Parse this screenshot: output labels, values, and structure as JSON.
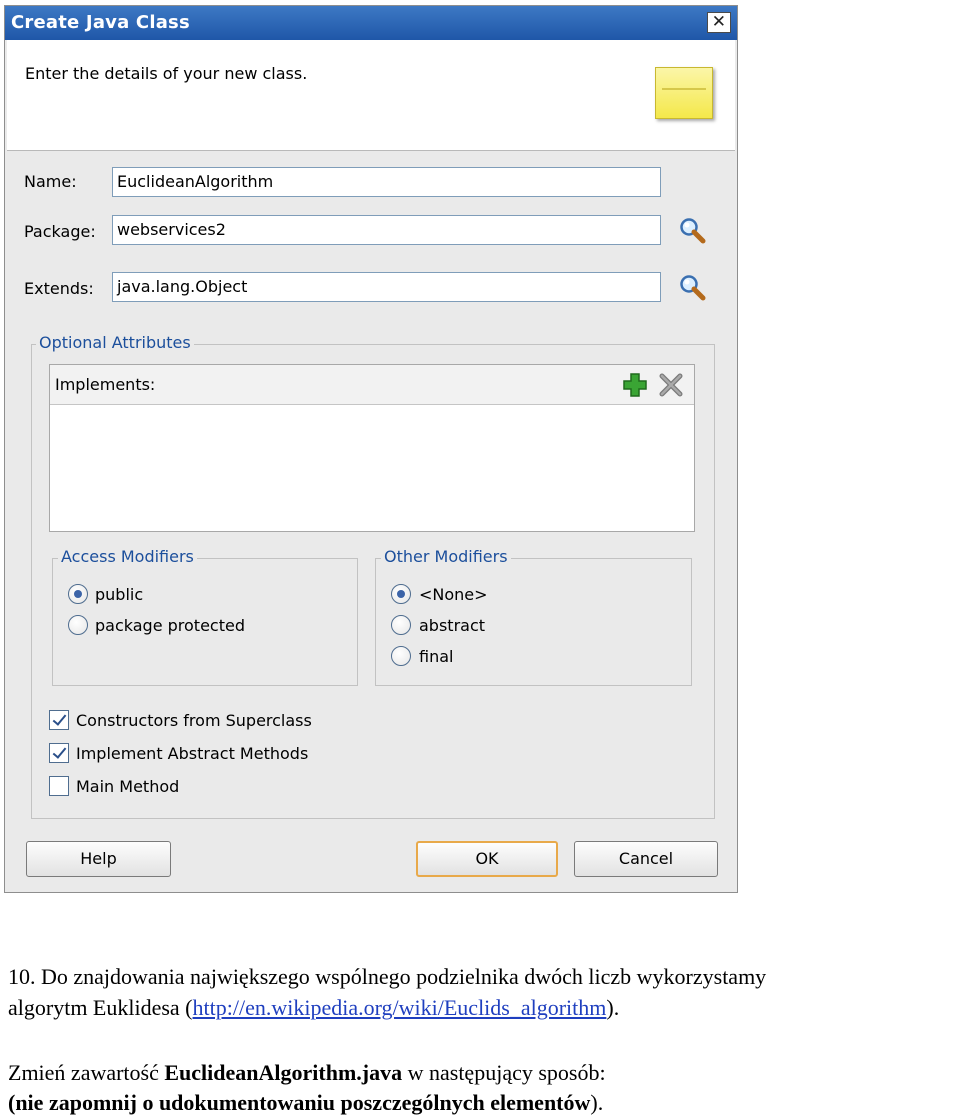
{
  "dialog": {
    "title": "Create Java Class",
    "close_label": "✕",
    "header_text": "Enter the details of your new class."
  },
  "fields": {
    "name_label": "Name:",
    "name_value": "EuclideanAlgorithm",
    "package_label": "Package:",
    "package_value": "webservices2",
    "extends_label": "Extends:",
    "extends_value": "java.lang.Object"
  },
  "optional": {
    "title": "Optional Attributes",
    "implements_label": "Implements:",
    "access": {
      "title": "Access Modifiers",
      "options": [
        "public",
        "package protected"
      ],
      "selected": "public"
    },
    "other": {
      "title": "Other Modifiers",
      "options": [
        "<None>",
        "abstract",
        "final"
      ],
      "selected": "<None>"
    },
    "checks": [
      {
        "label": "Constructors from Superclass",
        "checked": true
      },
      {
        "label": "Implement Abstract Methods",
        "checked": true
      },
      {
        "label": "Main Method",
        "checked": false
      }
    ]
  },
  "buttons": {
    "help": "Help",
    "ok": "OK",
    "cancel": "Cancel"
  },
  "document": {
    "line1": "10. Do znajdowania największego wspólnego podzielnika dwóch liczb wykorzystamy",
    "line2_pre": "algorytm Euklidesa (",
    "line2_link": "http://en.wikipedia.org/wiki/Euclids_algorithm",
    "line2_post": ").",
    "line3_pre": "Zmień zawartość ",
    "line3_bold": "EuclideanAlgorithm.java",
    "line3_post": " w następujący sposób:",
    "line4_bold": "(nie zapomnij o udokumentowaniu poszczególnych elementów",
    "line4_post": ")."
  },
  "colors": {
    "titlebar": "#1f57a8",
    "group_title": "#1c4f9c",
    "link": "#1f3fbf",
    "default_button_border": "#e8a94a"
  }
}
